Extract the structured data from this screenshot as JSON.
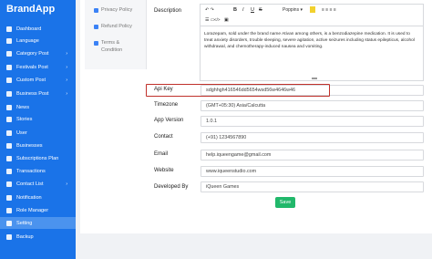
{
  "app": {
    "title": "BrandApp"
  },
  "sidebar": {
    "items": [
      {
        "label": "Dashboard",
        "icon": "dashboard-icon",
        "arrow": ""
      },
      {
        "label": "Language",
        "icon": "language-icon",
        "arrow": ""
      },
      {
        "label": "Category Post",
        "icon": "category-icon",
        "arrow": "›"
      },
      {
        "label": "Festivals Post",
        "icon": "festival-icon",
        "arrow": "›"
      },
      {
        "label": "Custom Post",
        "icon": "custom-post-icon",
        "arrow": "›"
      },
      {
        "label": "Business Post",
        "icon": "business-post-icon",
        "arrow": "›"
      },
      {
        "label": "News",
        "icon": "news-icon",
        "arrow": ""
      },
      {
        "label": "Stories",
        "icon": "stories-icon",
        "arrow": ""
      },
      {
        "label": "User",
        "icon": "user-icon",
        "arrow": ""
      },
      {
        "label": "Businesses",
        "icon": "businesses-icon",
        "arrow": ""
      },
      {
        "label": "Subscriptions Plan",
        "icon": "subscription-icon",
        "arrow": ""
      },
      {
        "label": "Transactions",
        "icon": "transactions-icon",
        "arrow": ""
      },
      {
        "label": "Contact List",
        "icon": "contact-icon",
        "arrow": "›"
      },
      {
        "label": "Notification",
        "icon": "notification-icon",
        "arrow": ""
      },
      {
        "label": "Role Manager",
        "icon": "role-icon",
        "arrow": ""
      },
      {
        "label": "Setting",
        "icon": "setting-icon",
        "arrow": ""
      },
      {
        "label": "Backup",
        "icon": "backup-icon",
        "arrow": ""
      }
    ],
    "active_label": "Setting"
  },
  "tabs": [
    {
      "label": "Privacy Policy",
      "icon": "document-icon"
    },
    {
      "label": "Refund Policy",
      "icon": "document-icon"
    },
    {
      "label": "Terms & Condition",
      "icon": "document-icon"
    }
  ],
  "form": {
    "description_label": "Description",
    "toolbar": {
      "bold": "B",
      "italic": "I",
      "underline": "U",
      "strike": "S",
      "font": "Poppins ▾",
      "code": "</>",
      "image": "▣"
    },
    "description_text": "Lorazepam, sold under the brand name Ativan among others, is a benzodiazepine medication. It is used to treat anxiety disorders, trouble sleeping, severe agitation, active seizures including status epilepticus, alcohol withdrawal, and chemotherapy-induced nausea and vomiting.",
    "fields": [
      {
        "label": "Api Key",
        "value": "sdghhgh416546dd5654wsd56w4646w46"
      },
      {
        "label": "Timezone",
        "value": "(GMT+05:30) Asia/Calcutta"
      },
      {
        "label": "App Version",
        "value": "1.0.1"
      },
      {
        "label": "Contact",
        "value": "(+91) 1234567890"
      },
      {
        "label": "Email",
        "value": "help.iqueengame@gmail.com"
      },
      {
        "label": "Website",
        "value": "www.iqueenstudio.com"
      },
      {
        "label": "Developed By",
        "value": "iQueen Games"
      }
    ],
    "save_label": "Save"
  },
  "colors": {
    "sidebar": "#1a73e8",
    "save": "#21b86b",
    "highlight": "#c0312b"
  }
}
